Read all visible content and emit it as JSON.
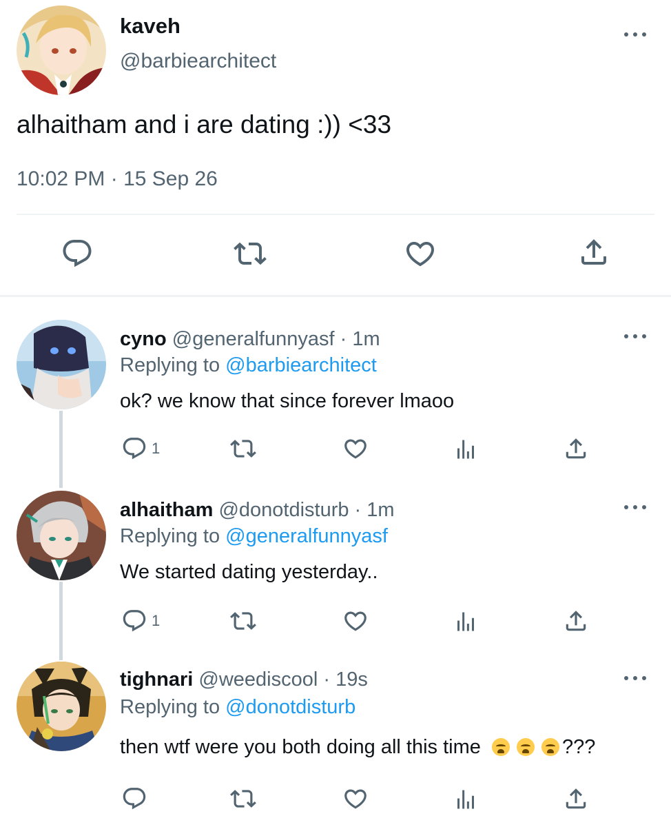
{
  "main_tweet": {
    "name": "kaveh",
    "handle": "@barbiearchitect",
    "text": "alhaitham and i are dating :)) <33",
    "timestamp": "10:02 PM · 15 Sep 26",
    "actions": [
      "reply-icon",
      "retweet-icon",
      "like-icon",
      "share-icon"
    ]
  },
  "replies": [
    {
      "name": "cyno",
      "meta": "@generalfunnyasf · 1m",
      "replying_prefix": "Replying to",
      "replying_to": "@barbiearchitect",
      "text": "ok? we know that since forever lmaoo",
      "reply_count": "1"
    },
    {
      "name": "alhaitham",
      "meta": "@donotdisturb · 1m",
      "replying_prefix": "Replying to",
      "replying_to": "@generalfunnyasf",
      "text": "We started dating yesterday..",
      "reply_count": "1"
    },
    {
      "name": "tighnari",
      "meta": "@weediscool · 19s",
      "replying_prefix": "Replying to",
      "replying_to": "@donotdisturb",
      "text": "then wtf were you both doing all this time",
      "text_suffix": "???",
      "emoji": [
        "loudly-crying-face",
        "loudly-crying-face",
        "loudly-crying-face"
      ],
      "reply_count": ""
    }
  ],
  "colors": {
    "text": "#0f1419",
    "secondary": "#536471",
    "link": "#1d9bf0",
    "divider": "#eff3f4",
    "thread_line": "#cfd9de"
  }
}
